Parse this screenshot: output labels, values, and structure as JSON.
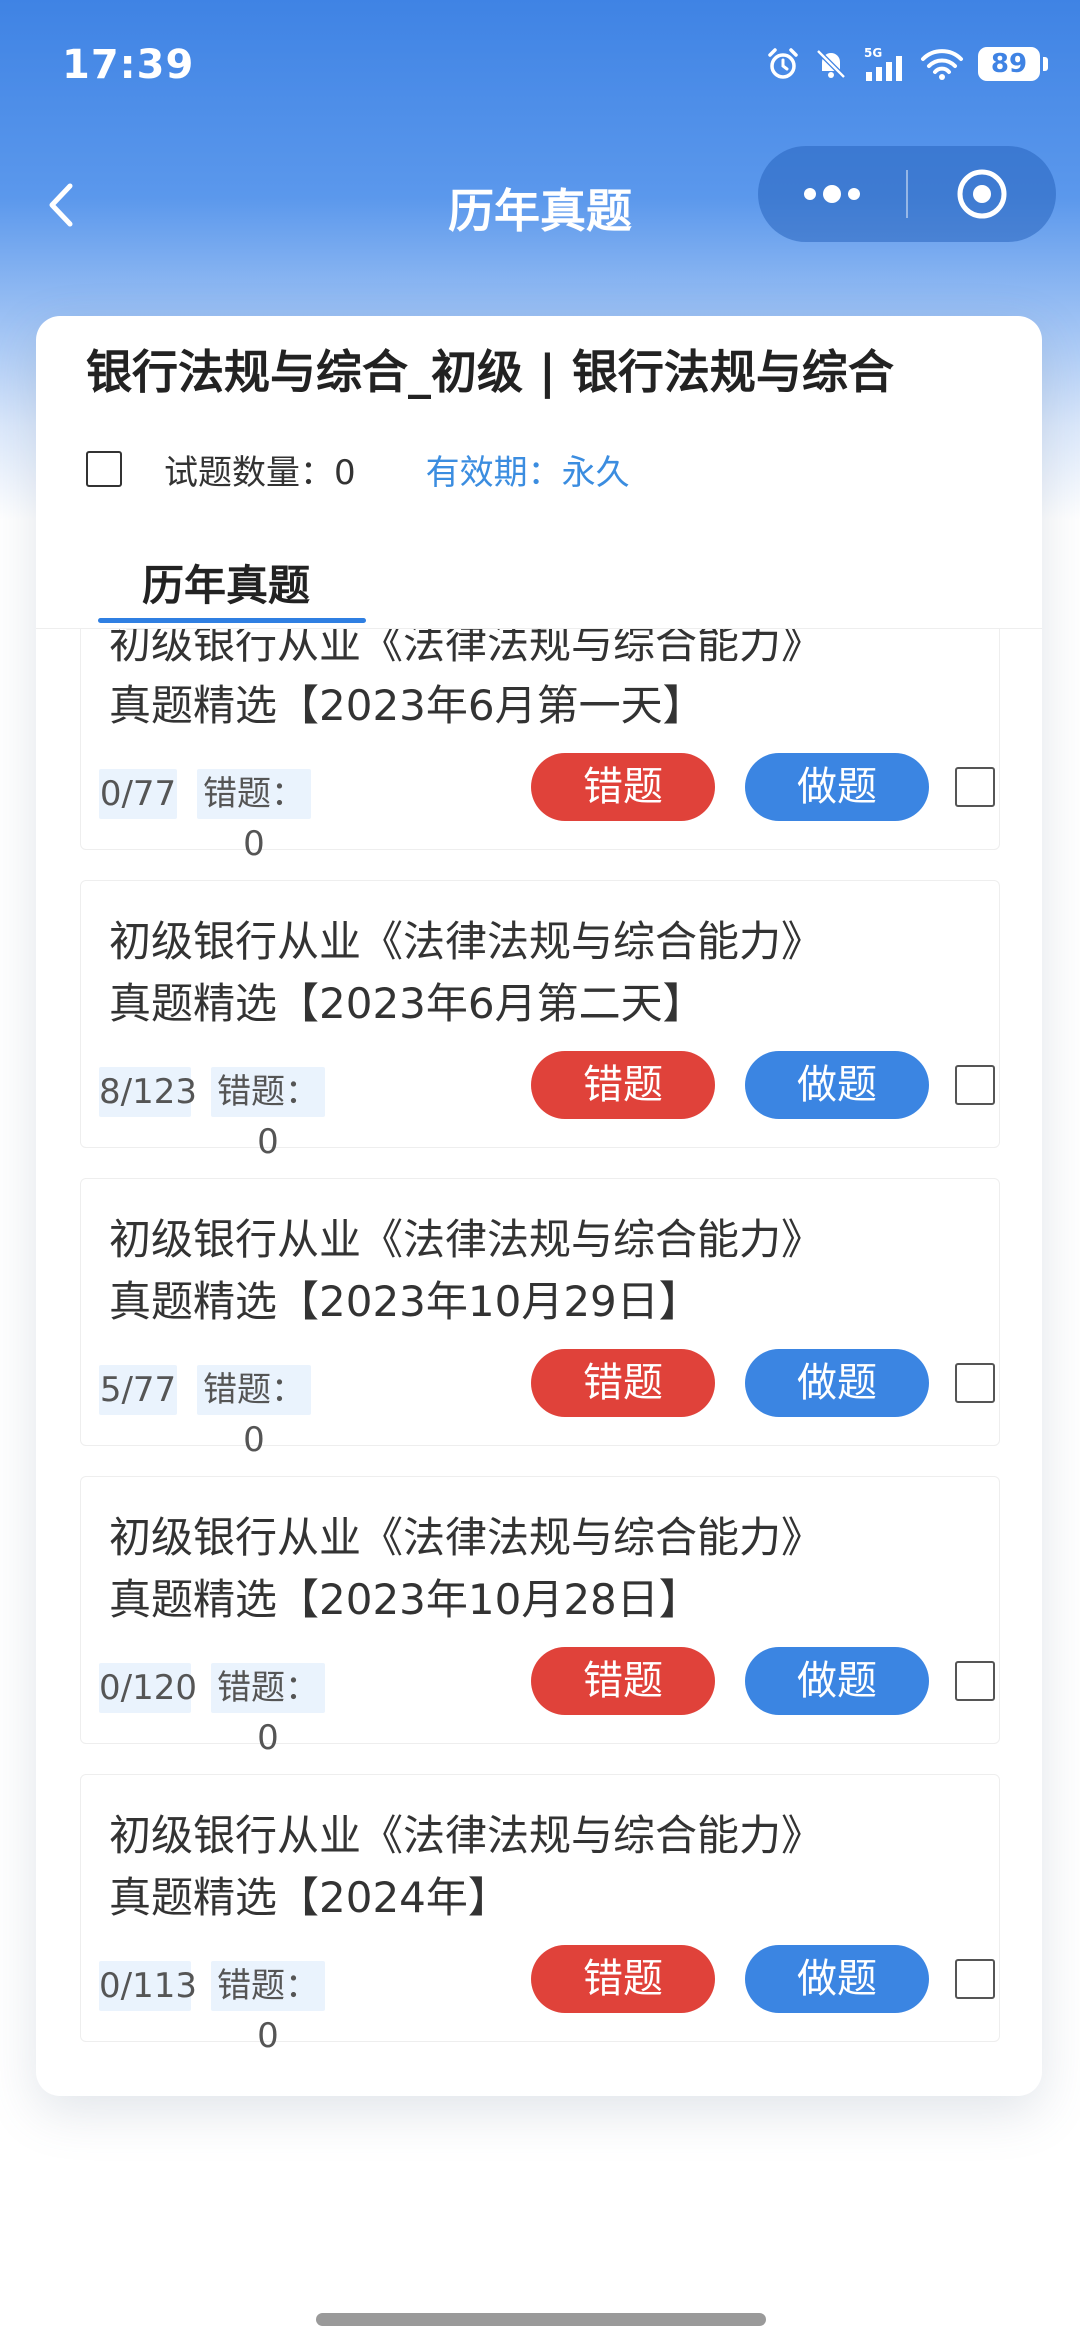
{
  "status_bar": {
    "time": "17:39",
    "network": "5G",
    "battery": "89"
  },
  "nav": {
    "title": "历年真题"
  },
  "course": {
    "title": "银行法规与综合_初级 | 银行法规与综合",
    "question_count": "试题数量：0",
    "validity": "有效期：永久"
  },
  "tabs": [
    {
      "label": "历年真题",
      "active": true
    }
  ],
  "items": [
    {
      "line1": "初级银行从业《法律法规与综合能力》",
      "line2": "真题精选【2023年6月第一天】",
      "progress": "0/77",
      "wrong": "错题：0",
      "wrong_btn": "错题",
      "do_btn": "做题"
    },
    {
      "line1": "初级银行从业《法律法规与综合能力》",
      "line2": "真题精选【2023年6月第二天】",
      "progress": "8/123",
      "wrong": "错题：0",
      "wrong_btn": "错题",
      "do_btn": "做题"
    },
    {
      "line1": "初级银行从业《法律法规与综合能力》",
      "line2": "真题精选【2023年10月29日】",
      "progress": "5/77",
      "wrong": "错题：0",
      "wrong_btn": "错题",
      "do_btn": "做题"
    },
    {
      "line1": "初级银行从业《法律法规与综合能力》",
      "line2": "真题精选【2023年10月28日】",
      "progress": "0/120",
      "wrong": "错题：0",
      "wrong_btn": "错题",
      "do_btn": "做题"
    },
    {
      "line1": "初级银行从业《法律法规与综合能力》",
      "line2": "真题精选【2024年】",
      "progress": "0/113",
      "wrong": "错题：0",
      "wrong_btn": "错题",
      "do_btn": "做题"
    }
  ],
  "colors": {
    "accent": "#3b85e2",
    "danger": "#e0423a",
    "link": "#3b8de0"
  }
}
